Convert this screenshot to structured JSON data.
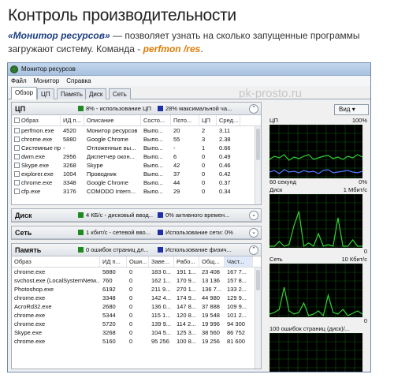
{
  "article": {
    "heading": "Контроль производительности",
    "intro_bold": "«Монитор ресурсов»",
    "intro_text": " — позволяет узнать на сколько запущенные программы загружают систему. Команда - ",
    "intro_cmd": "perfmon /res",
    "intro_end": "."
  },
  "window": {
    "title": "Монитор ресурсов",
    "watermark": "pk-prosto.ru",
    "menu": [
      "Файл",
      "Монитор",
      "Справка"
    ],
    "tabs": [
      "Обзор",
      "ЦП",
      "Память",
      "Диск",
      "Сеть"
    ],
    "active_tab": "Обзор",
    "view_button": "Вид"
  },
  "colors": {
    "green": "#1f8a1f",
    "blue": "#1e2fa8",
    "graph_bg": "#000000",
    "graph_grid": "#0b5a0b",
    "graph_line": "#34d234",
    "graph_line2": "#4f7cff"
  },
  "cpu": {
    "title": "ЦП",
    "stat1": "8% - использование ЦП",
    "stat2": "28% максимальной ча...",
    "columns": [
      "Образ",
      "ИД п...",
      "Описание",
      "Состо...",
      "Пото...",
      "ЦП",
      "Сред..."
    ],
    "rows": [
      [
        "perfmon.exe",
        "4520",
        "Монитор ресурсов",
        "Выпо...",
        "20",
        "2",
        "3.11"
      ],
      [
        "chrome.exe",
        "5880",
        "Google Chrome",
        "Выпо...",
        "55",
        "3",
        "2.38"
      ],
      [
        "Системные пр...",
        "-",
        "Отложенные вы...",
        "Выпо...",
        "-",
        "1",
        "0.66"
      ],
      [
        "dwm.exe",
        "2956",
        "Диспетчер окон...",
        "Выпо...",
        "6",
        "0",
        "0.49"
      ],
      [
        "Skype.exe",
        "3268",
        "Skype",
        "Выпо...",
        "42",
        "0",
        "0.46"
      ],
      [
        "explorer.exe",
        "1004",
        "Проводник",
        "Выпо...",
        "37",
        "0",
        "0.42"
      ],
      [
        "chrome.exe",
        "3348",
        "Google Chrome",
        "Выпо...",
        "44",
        "0",
        "0.37"
      ],
      [
        "cfp.exe",
        "3176",
        "COMODO Intern...",
        "Выпо...",
        "29",
        "0",
        "0.34"
      ]
    ]
  },
  "disk": {
    "title": "Диск",
    "stat1": "4 КБ/с - дисковый ввод...",
    "stat2": "0% активного времен..."
  },
  "net": {
    "title": "Сеть",
    "stat1": "1 кбит/с - сетевой вво...",
    "stat2": "Использование сети: 0%"
  },
  "mem": {
    "title": "Память",
    "stat1": "0 ошибок страниц дл...",
    "stat2": "Использование физич...",
    "columns": [
      "Образ",
      "ИД п...",
      "Оши...",
      "Заве...",
      "Рабо...",
      "Общ...",
      "Част..."
    ],
    "rows": [
      [
        "chrome.exe",
        "5880",
        "0",
        "183 0...",
        "191 1...",
        "23 408",
        "167 7..."
      ],
      [
        "svchost.exe (LocalSystemNetw...",
        "760",
        "0",
        "162 1...",
        "170 9...",
        "13 136",
        "157 8..."
      ],
      [
        "Photoshop.exe",
        "6192",
        "0",
        "211 9...",
        "270 1...",
        "136 7...",
        "133 2..."
      ],
      [
        "chrome.exe",
        "3348",
        "0",
        "142 4...",
        "174 9...",
        "44 980",
        "129 9..."
      ],
      [
        "AcroRd32.exe",
        "2680",
        "0",
        "136 0...",
        "147 8...",
        "37 888",
        "109 9..."
      ],
      [
        "chrome.exe",
        "5344",
        "0",
        "115 1...",
        "120 8...",
        "19 548",
        "101 2..."
      ],
      [
        "chrome.exe",
        "5720",
        "0",
        "139 9...",
        "114 2...",
        "19 996",
        "94 300"
      ],
      [
        "Skype.exe",
        "3268",
        "0",
        "104 5...",
        "125 3...",
        "38 560",
        "86 752"
      ],
      [
        "chrome.exe",
        "5160",
        "0",
        "95 256",
        "100 8...",
        "19 256",
        "81 600"
      ]
    ]
  },
  "graphs": [
    {
      "label": "ЦП",
      "max": "100%",
      "bottom": "60 секунд",
      "bottom_right": "0%"
    },
    {
      "label": "Диск",
      "max": "1 Мбит/с",
      "bottom": "",
      "bottom_right": "0"
    },
    {
      "label": "Сеть",
      "max": "10 Кбит/с",
      "bottom": "",
      "bottom_right": "0"
    },
    {
      "label": "100 ошибок страниц (диск)/...",
      "max": "",
      "bottom": "",
      "bottom_right": ""
    }
  ]
}
